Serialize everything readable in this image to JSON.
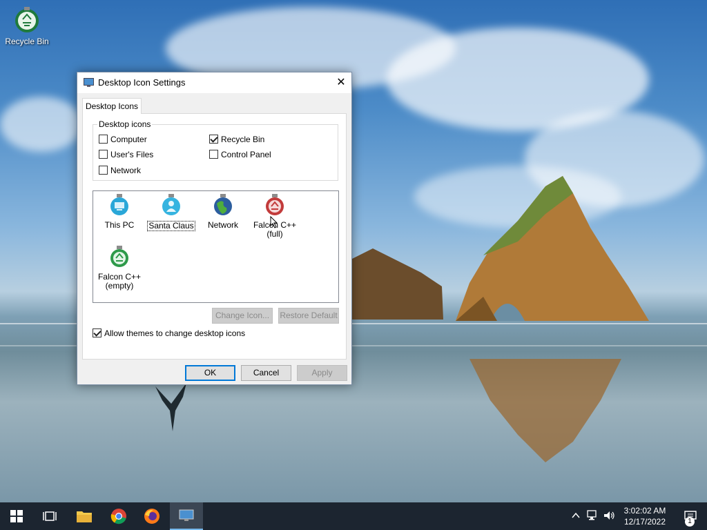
{
  "desktop": {
    "icons": [
      {
        "label": "Recycle Bin",
        "icon": "recycle-bin-icon"
      }
    ]
  },
  "dialog": {
    "title": "Desktop Icon Settings",
    "close_symbol": "✕",
    "tab_label": "Desktop Icons",
    "group_label": "Desktop icons",
    "checkboxes": {
      "computer": {
        "label": "Computer",
        "checked": false
      },
      "recycle_bin": {
        "label": "Recycle Bin",
        "checked": true
      },
      "users_files": {
        "label": "User's Files",
        "checked": false
      },
      "control_panel": {
        "label": "Control Panel",
        "checked": false
      },
      "network": {
        "label": "Network",
        "checked": false
      }
    },
    "icon_list": [
      {
        "label": "This PC",
        "icon": "this-pc-icon",
        "color": "#2aa7d8"
      },
      {
        "label": "Santa Claus",
        "icon": "user-folder-icon",
        "color": "#36b4e0",
        "focused": true
      },
      {
        "label": "Network",
        "icon": "network-globe-icon",
        "color": "#3a9a3a"
      },
      {
        "label": "Falcon C++",
        "label2": "(full)",
        "icon": "recycle-bin-full-icon",
        "color": "#c23b3b"
      },
      {
        "label": "Falcon C++",
        "label2": "(empty)",
        "icon": "recycle-bin-empty-icon",
        "color": "#2e9a4a"
      }
    ],
    "change_icon_label": "Change Icon...",
    "restore_default_label": "Restore Default",
    "allow_themes": {
      "label": "Allow themes to change desktop icons",
      "checked": true
    },
    "ok_label": "OK",
    "cancel_label": "Cancel",
    "apply_label": "Apply"
  },
  "taskbar": {
    "items": [
      "start-icon",
      "task-view-icon",
      "file-explorer-icon",
      "chrome-icon",
      "firefox-icon",
      "display-settings-icon"
    ],
    "time": "3:02:02 AM",
    "date": "12/17/2022",
    "notification_count": "1"
  }
}
